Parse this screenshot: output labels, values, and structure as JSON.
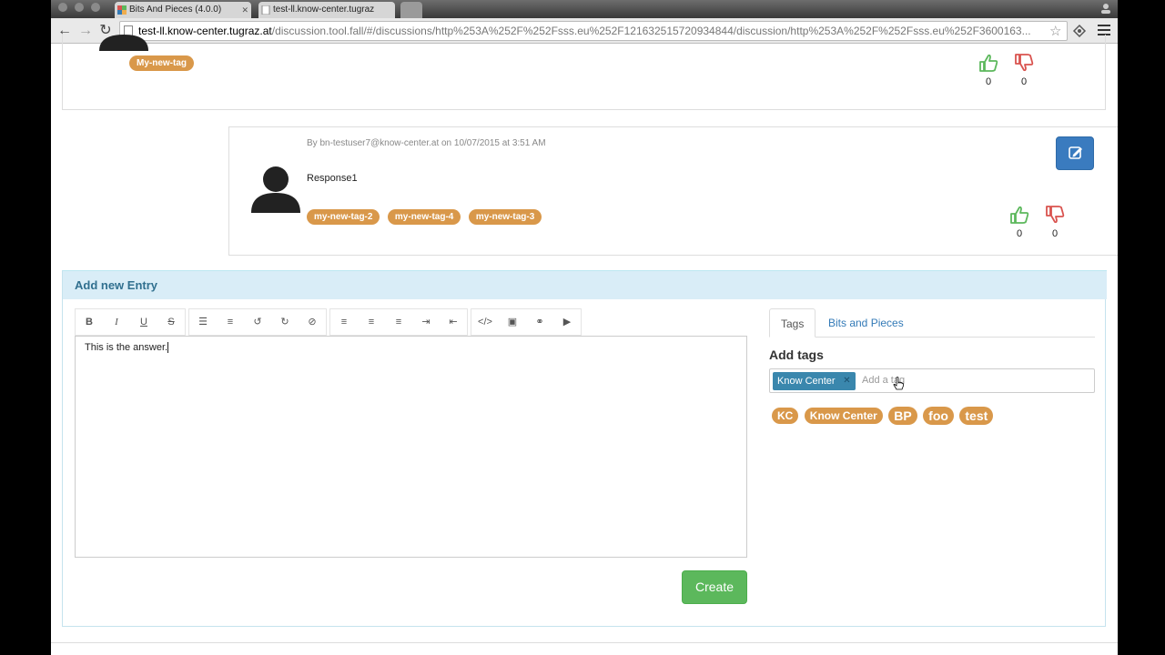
{
  "browser": {
    "tabs": [
      {
        "title": "Bits And Pieces (4.0.0)",
        "active": true
      },
      {
        "title": "test-ll.know-center.tugraz",
        "active": false
      }
    ],
    "url_host": "test-ll.know-center.tugraz.at",
    "url_path": "/discussion.tool.fall/#/discussions/http%253A%252F%252Fsss.eu%252F121632515720934844/discussion/http%253A%252F%252Fsss.eu%252F3600163..."
  },
  "previous_entry": {
    "tags": [
      "My-new-tag"
    ],
    "likes": "0",
    "dislikes": "0"
  },
  "response": {
    "byline": "By bn-testuser7@know-center.at on 10/07/2015 at 3:51 AM",
    "text": "Response1",
    "tags": [
      "my-new-tag-2",
      "my-new-tag-4",
      "my-new-tag-3"
    ],
    "likes": "0",
    "dislikes": "0"
  },
  "new_entry": {
    "heading": "Add new Entry",
    "editor_text": "This is the answer.",
    "create_label": "Create",
    "toolbar_icons": [
      [
        "bold-icon",
        "italic-icon",
        "underline-icon",
        "strikethrough-icon"
      ],
      [
        "bullet-list-icon",
        "numbered-list-icon",
        "undo-icon",
        "redo-icon",
        "clear-format-icon"
      ],
      [
        "align-left-icon",
        "align-center-icon",
        "align-right-icon",
        "indent-icon",
        "outdent-icon"
      ],
      [
        "html-code-icon",
        "image-icon",
        "link-icon",
        "video-icon"
      ]
    ]
  },
  "side": {
    "tab_tags": "Tags",
    "tab_bits": "Bits and Pieces",
    "add_tags_title": "Add tags",
    "selected_tag": "Know Center",
    "tag_placeholder": "Add a tag",
    "cloud": [
      {
        "label": "KC",
        "size": 12
      },
      {
        "label": "Know Center",
        "size": 12
      },
      {
        "label": "BP",
        "size": 14
      },
      {
        "label": "foo",
        "size": 14
      },
      {
        "label": "test",
        "size": 14
      }
    ]
  },
  "colors": {
    "tag": "#d9984a",
    "like": "#5cb85c",
    "dislike": "#d9534f",
    "primary": "#3a7bbf",
    "create": "#5cb85c"
  }
}
